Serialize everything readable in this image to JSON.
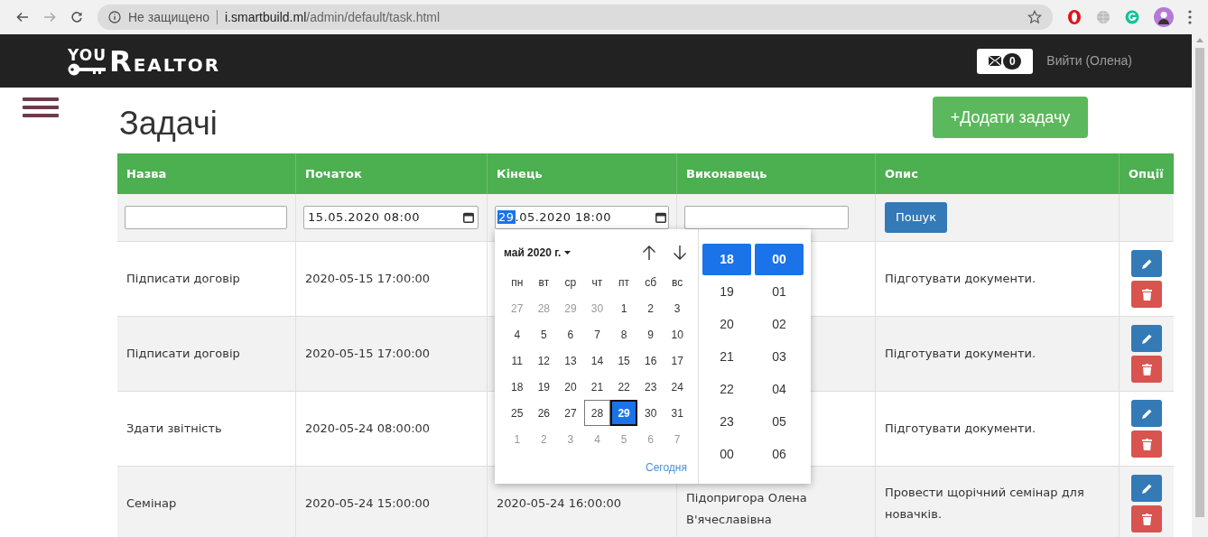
{
  "browser": {
    "security": "Не защищено",
    "host": "i.smartbuild.ml",
    "path": "/admin/default/task.html"
  },
  "navbar": {
    "logo_top": "YOU",
    "logo_main": "REALTOR",
    "messages_count": "0",
    "logout": "Вийти (Олена)"
  },
  "page": {
    "title": "Задачі",
    "add_button": "+Додати задачу"
  },
  "table": {
    "columns": [
      "Назва",
      "Початок",
      "Кінець",
      "Виконавець",
      "Опис",
      "Опції"
    ],
    "filters": {
      "start": "15.05.2020 08:00",
      "end_highlighted": "29",
      "end_rest": ".05.2020 18:00",
      "search_button": "Пошук"
    },
    "rows": [
      {
        "name": "Підписати договір",
        "start": "2020-05-15 17:00:00",
        "description": "Підготувати документи."
      },
      {
        "name": "Підписати договір",
        "start": "2020-05-15 17:00:00",
        "description": "Підготувати документи."
      },
      {
        "name": "Здати звітність",
        "start": "2020-05-24 08:00:00",
        "description": "Підготувати документи."
      },
      {
        "name": "Семінар",
        "start": "2020-05-24 15:00:00",
        "end": "2020-05-24 16:00:00",
        "executor": "Підопригора Олена В'ячеславівна",
        "description": "Провести щорічний семінар для новачків."
      }
    ]
  },
  "picker": {
    "month": "май 2020 г.",
    "weekdays": [
      "пн",
      "вт",
      "ср",
      "чт",
      "пт",
      "сб",
      "вс"
    ],
    "days": [
      {
        "label": "27",
        "outside": true,
        "today": false,
        "selected": false
      },
      {
        "label": "28",
        "outside": true,
        "today": false,
        "selected": false
      },
      {
        "label": "29",
        "outside": true,
        "today": false,
        "selected": false
      },
      {
        "label": "30",
        "outside": true,
        "today": false,
        "selected": false
      },
      {
        "label": "1",
        "outside": false,
        "today": false,
        "selected": false
      },
      {
        "label": "2",
        "outside": false,
        "today": false,
        "selected": false
      },
      {
        "label": "3",
        "outside": false,
        "today": false,
        "selected": false
      },
      {
        "label": "4",
        "outside": false,
        "today": false,
        "selected": false
      },
      {
        "label": "5",
        "outside": false,
        "today": false,
        "selected": false
      },
      {
        "label": "6",
        "outside": false,
        "today": false,
        "selected": false
      },
      {
        "label": "7",
        "outside": false,
        "today": false,
        "selected": false
      },
      {
        "label": "8",
        "outside": false,
        "today": false,
        "selected": false
      },
      {
        "label": "9",
        "outside": false,
        "today": false,
        "selected": false
      },
      {
        "label": "10",
        "outside": false,
        "today": false,
        "selected": false
      },
      {
        "label": "11",
        "outside": false,
        "today": false,
        "selected": false
      },
      {
        "label": "12",
        "outside": false,
        "today": false,
        "selected": false
      },
      {
        "label": "13",
        "outside": false,
        "today": false,
        "selected": false
      },
      {
        "label": "14",
        "outside": false,
        "today": false,
        "selected": false
      },
      {
        "label": "15",
        "outside": false,
        "today": false,
        "selected": false
      },
      {
        "label": "16",
        "outside": false,
        "today": false,
        "selected": false
      },
      {
        "label": "17",
        "outside": false,
        "today": false,
        "selected": false
      },
      {
        "label": "18",
        "outside": false,
        "today": false,
        "selected": false
      },
      {
        "label": "19",
        "outside": false,
        "today": false,
        "selected": false
      },
      {
        "label": "20",
        "outside": false,
        "today": false,
        "selected": false
      },
      {
        "label": "21",
        "outside": false,
        "today": false,
        "selected": false
      },
      {
        "label": "22",
        "outside": false,
        "today": false,
        "selected": false
      },
      {
        "label": "23",
        "outside": false,
        "today": false,
        "selected": false
      },
      {
        "label": "24",
        "outside": false,
        "today": false,
        "selected": false
      },
      {
        "label": "25",
        "outside": false,
        "today": false,
        "selected": false
      },
      {
        "label": "26",
        "outside": false,
        "today": false,
        "selected": false
      },
      {
        "label": "27",
        "outside": false,
        "today": false,
        "selected": false
      },
      {
        "label": "28",
        "outside": false,
        "today": true,
        "selected": false
      },
      {
        "label": "29",
        "outside": false,
        "today": false,
        "selected": true
      },
      {
        "label": "30",
        "outside": false,
        "today": false,
        "selected": false
      },
      {
        "label": "31",
        "outside": false,
        "today": false,
        "selected": false
      },
      {
        "label": "1",
        "outside": true,
        "today": false,
        "selected": false
      },
      {
        "label": "2",
        "outside": true,
        "today": false,
        "selected": false
      },
      {
        "label": "3",
        "outside": true,
        "today": false,
        "selected": false
      },
      {
        "label": "4",
        "outside": true,
        "today": false,
        "selected": false
      },
      {
        "label": "5",
        "outside": true,
        "today": false,
        "selected": false
      },
      {
        "label": "6",
        "outside": true,
        "today": false,
        "selected": false
      },
      {
        "label": "7",
        "outside": true,
        "today": false,
        "selected": false
      }
    ],
    "today_link": "Сегодня",
    "hours": [
      {
        "label": "18",
        "selected": true
      },
      {
        "label": "19",
        "selected": false
      },
      {
        "label": "20",
        "selected": false
      },
      {
        "label": "21",
        "selected": false
      },
      {
        "label": "22",
        "selected": false
      },
      {
        "label": "23",
        "selected": false
      },
      {
        "label": "00",
        "selected": false
      }
    ],
    "minutes": [
      {
        "label": "00",
        "selected": true
      },
      {
        "label": "01",
        "selected": false
      },
      {
        "label": "02",
        "selected": false
      },
      {
        "label": "03",
        "selected": false
      },
      {
        "label": "04",
        "selected": false
      },
      {
        "label": "05",
        "selected": false
      },
      {
        "label": "06",
        "selected": false
      }
    ]
  }
}
